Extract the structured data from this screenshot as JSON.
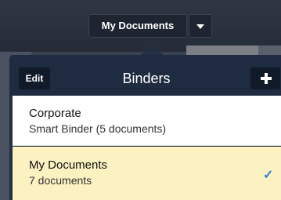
{
  "toolbar": {
    "title": "My Documents"
  },
  "binders": {
    "edit_label": "Edit",
    "title": "Binders",
    "items": [
      {
        "title": "Corporate",
        "subtitle": "Smart Binder (5 documents)",
        "selected": false
      },
      {
        "title": "My Documents",
        "subtitle": "7 documents",
        "selected": true
      }
    ]
  },
  "icons": {
    "dropdown": "chevron-down-icon",
    "add": "plus-icon",
    "check": "checkmark-icon"
  },
  "colors": {
    "popover_bg": "#243046",
    "selected_row": "#fbf1c1",
    "check": "#2f7fd8"
  }
}
